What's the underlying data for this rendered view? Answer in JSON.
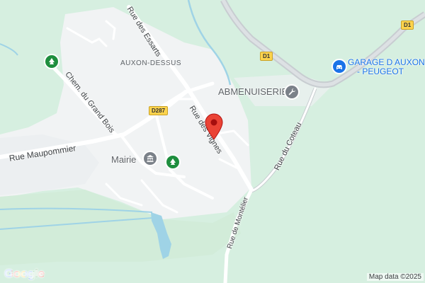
{
  "map": {
    "colors": {
      "background": "#d6efe0",
      "urban": "#f1f3f4",
      "road": "#ffffff",
      "highway": "#c8cdd1",
      "water": "#9fd3e6",
      "park_icon": "#1e8e3e",
      "marker": "#ea4335",
      "shield": "#fcd34d"
    },
    "streets": {
      "rue_des_essarts": "Rue des Essarts",
      "rue_des_vignes": "Rue des Vignes",
      "chem_du_grand_bois": "Chem. du Grand Bois",
      "rue_maupommier": "Rue Maupommier",
      "rue_du_coteau": "Rue du Coteau",
      "rue_de_montelier": "Rue de Montélier"
    },
    "route_shields": {
      "d287": "D287",
      "d1_center": "D1",
      "d1_topright": "D1"
    },
    "places": {
      "auxon_dessus": "AUXON-DESSUS"
    },
    "pois": {
      "abmenuiserie": {
        "label": "ABMENUISERIE",
        "icon": "wrench-icon"
      },
      "mairie": {
        "label": "Mairie",
        "icon": "town-hall-icon"
      },
      "garage": {
        "label_line1": "GARAGE D AUXON",
        "label_line2": "- PEUGEOT",
        "icon": "car-service-icon"
      },
      "park_nw": {
        "icon": "tree-icon"
      },
      "park_center": {
        "icon": "tree-icon"
      }
    },
    "marker": {
      "icon": "location-pin-icon"
    },
    "attribution": "Map data ©2025",
    "logo": "Google"
  }
}
